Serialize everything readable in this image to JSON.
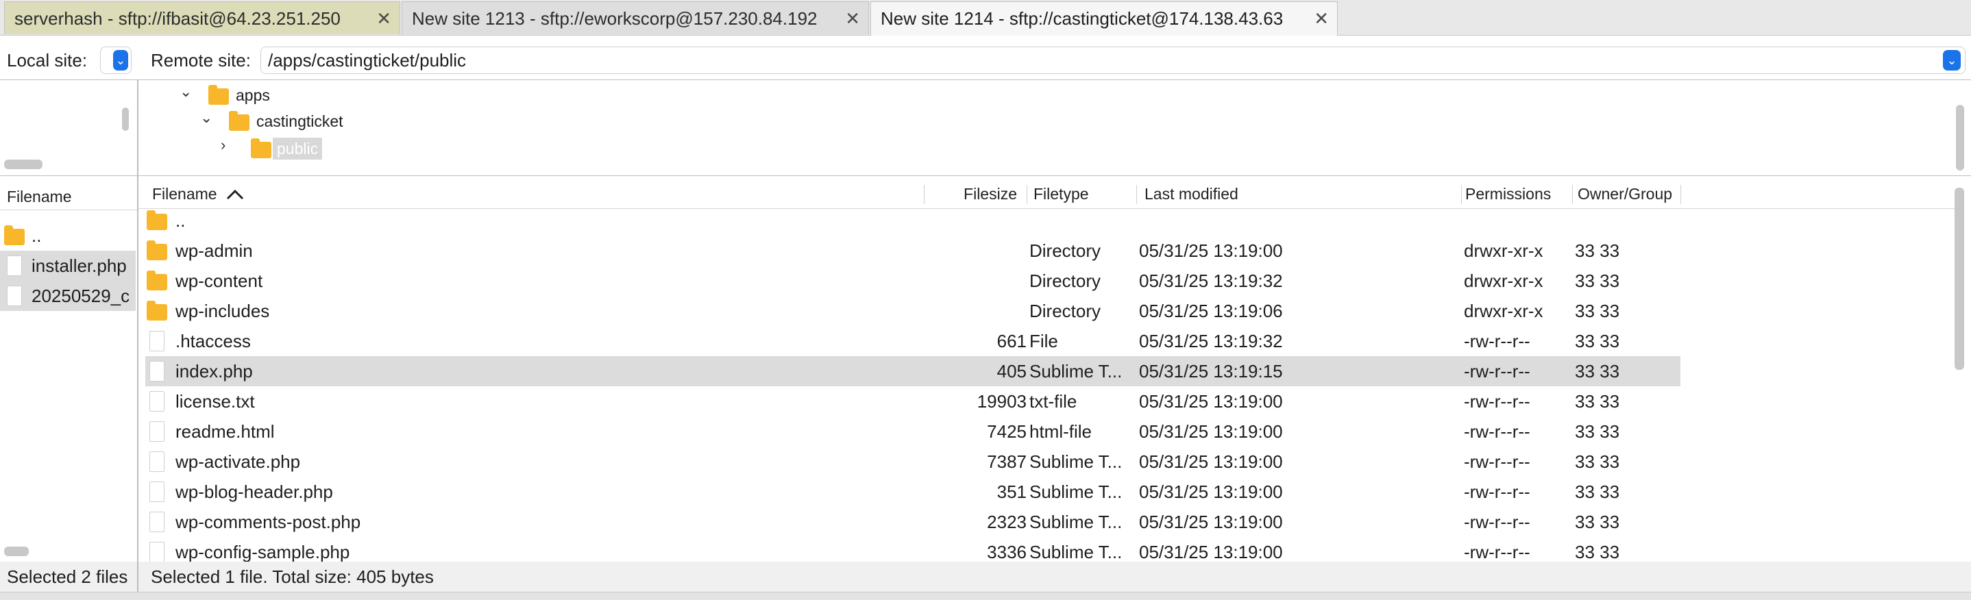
{
  "tabs": [
    {
      "label": "serverhash - sftp://ifbasit@64.23.251.250"
    },
    {
      "label": "New site 1213 - sftp://eworkscorp@157.230.84.192"
    },
    {
      "label": "New site 1214 - sftp://castingticket@174.138.43.63"
    }
  ],
  "local": {
    "site_label": "Local site:",
    "filename_header": "Filename",
    "files": [
      {
        "name": "..",
        "icon": "folder-icon"
      },
      {
        "name": "installer.php",
        "icon": "file-icon"
      },
      {
        "name": "20250529_c",
        "icon": "file-icon"
      }
    ],
    "status": "Selected 2 files"
  },
  "remote": {
    "site_label": "Remote site:",
    "path": "/apps/castingticket/public",
    "tree": [
      {
        "name": "apps"
      },
      {
        "name": "castingticket"
      },
      {
        "name": "public"
      }
    ],
    "headers": {
      "filename": "Filename",
      "filesize": "Filesize",
      "filetype": "Filetype",
      "last_modified": "Last modified",
      "permissions": "Permissions",
      "owner": "Owner/Group"
    },
    "files": [
      {
        "name": "..",
        "size": "",
        "type": "",
        "modified": "",
        "perms": "",
        "owner": ""
      },
      {
        "name": "wp-admin",
        "size": "",
        "type": "Directory",
        "modified": "05/31/25 13:19:00",
        "perms": "drwxr-xr-x",
        "owner": "33 33"
      },
      {
        "name": "wp-content",
        "size": "",
        "type": "Directory",
        "modified": "05/31/25 13:19:32",
        "perms": "drwxr-xr-x",
        "owner": "33 33"
      },
      {
        "name": "wp-includes",
        "size": "",
        "type": "Directory",
        "modified": "05/31/25 13:19:06",
        "perms": "drwxr-xr-x",
        "owner": "33 33"
      },
      {
        "name": ".htaccess",
        "size": "661",
        "type": "File",
        "modified": "05/31/25 13:19:32",
        "perms": "-rw-r--r--",
        "owner": "33 33"
      },
      {
        "name": "index.php",
        "size": "405",
        "type": "Sublime T...",
        "modified": "05/31/25 13:19:15",
        "perms": "-rw-r--r--",
        "owner": "33 33"
      },
      {
        "name": "license.txt",
        "size": "19903",
        "type": "txt-file",
        "modified": "05/31/25 13:19:00",
        "perms": "-rw-r--r--",
        "owner": "33 33"
      },
      {
        "name": "readme.html",
        "size": "7425",
        "type": "html-file",
        "modified": "05/31/25 13:19:00",
        "perms": "-rw-r--r--",
        "owner": "33 33"
      },
      {
        "name": "wp-activate.php",
        "size": "7387",
        "type": "Sublime T...",
        "modified": "05/31/25 13:19:00",
        "perms": "-rw-r--r--",
        "owner": "33 33"
      },
      {
        "name": "wp-blog-header.php",
        "size": "351",
        "type": "Sublime T...",
        "modified": "05/31/25 13:19:00",
        "perms": "-rw-r--r--",
        "owner": "33 33"
      },
      {
        "name": "wp-comments-post.php",
        "size": "2323",
        "type": "Sublime T...",
        "modified": "05/31/25 13:19:00",
        "perms": "-rw-r--r--",
        "owner": "33 33"
      },
      {
        "name": "wp-config-sample.php",
        "size": "3336",
        "type": "Sublime T...",
        "modified": "05/31/25 13:19:00",
        "perms": "-rw-r--r--",
        "owner": "33 33"
      }
    ],
    "status": "Selected 1 file. Total size: 405 bytes"
  },
  "colors": {
    "accent": "#1a73e8",
    "folder": "#f8b62a",
    "selection": "#dcdcdc"
  }
}
